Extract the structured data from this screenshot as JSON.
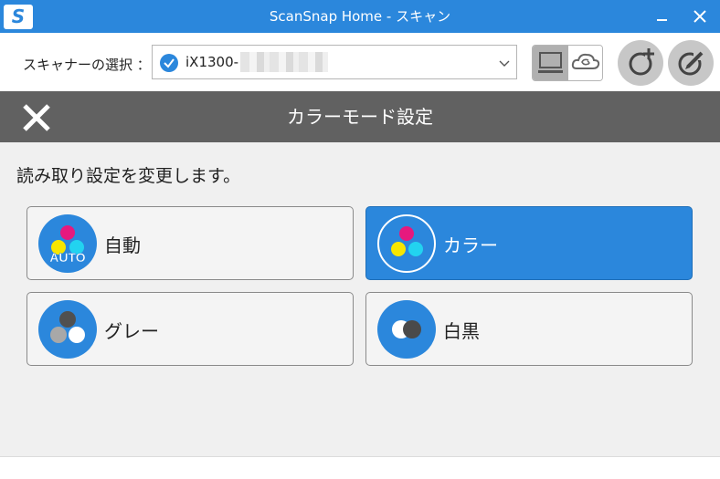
{
  "window": {
    "title": "ScanSnap Home - スキャン",
    "logo_letter": "S"
  },
  "scanner": {
    "label": "スキャナーの選択 ：",
    "selected_value": "iX1300-"
  },
  "dialog": {
    "title": "カラーモード設定",
    "instruction": "読み取り設定を変更します。"
  },
  "modes": [
    {
      "label": "自動",
      "icon_badge": "AUTO",
      "selected": false
    },
    {
      "label": "カラー",
      "selected": true
    },
    {
      "label": "グレー",
      "selected": false
    },
    {
      "label": "白黒",
      "selected": false
    }
  ],
  "colors": {
    "accent": "#2b87dc",
    "header_dark": "#616161",
    "magenta": "#e6197e",
    "yellow": "#f7e600",
    "cyan": "#22d3f0"
  }
}
